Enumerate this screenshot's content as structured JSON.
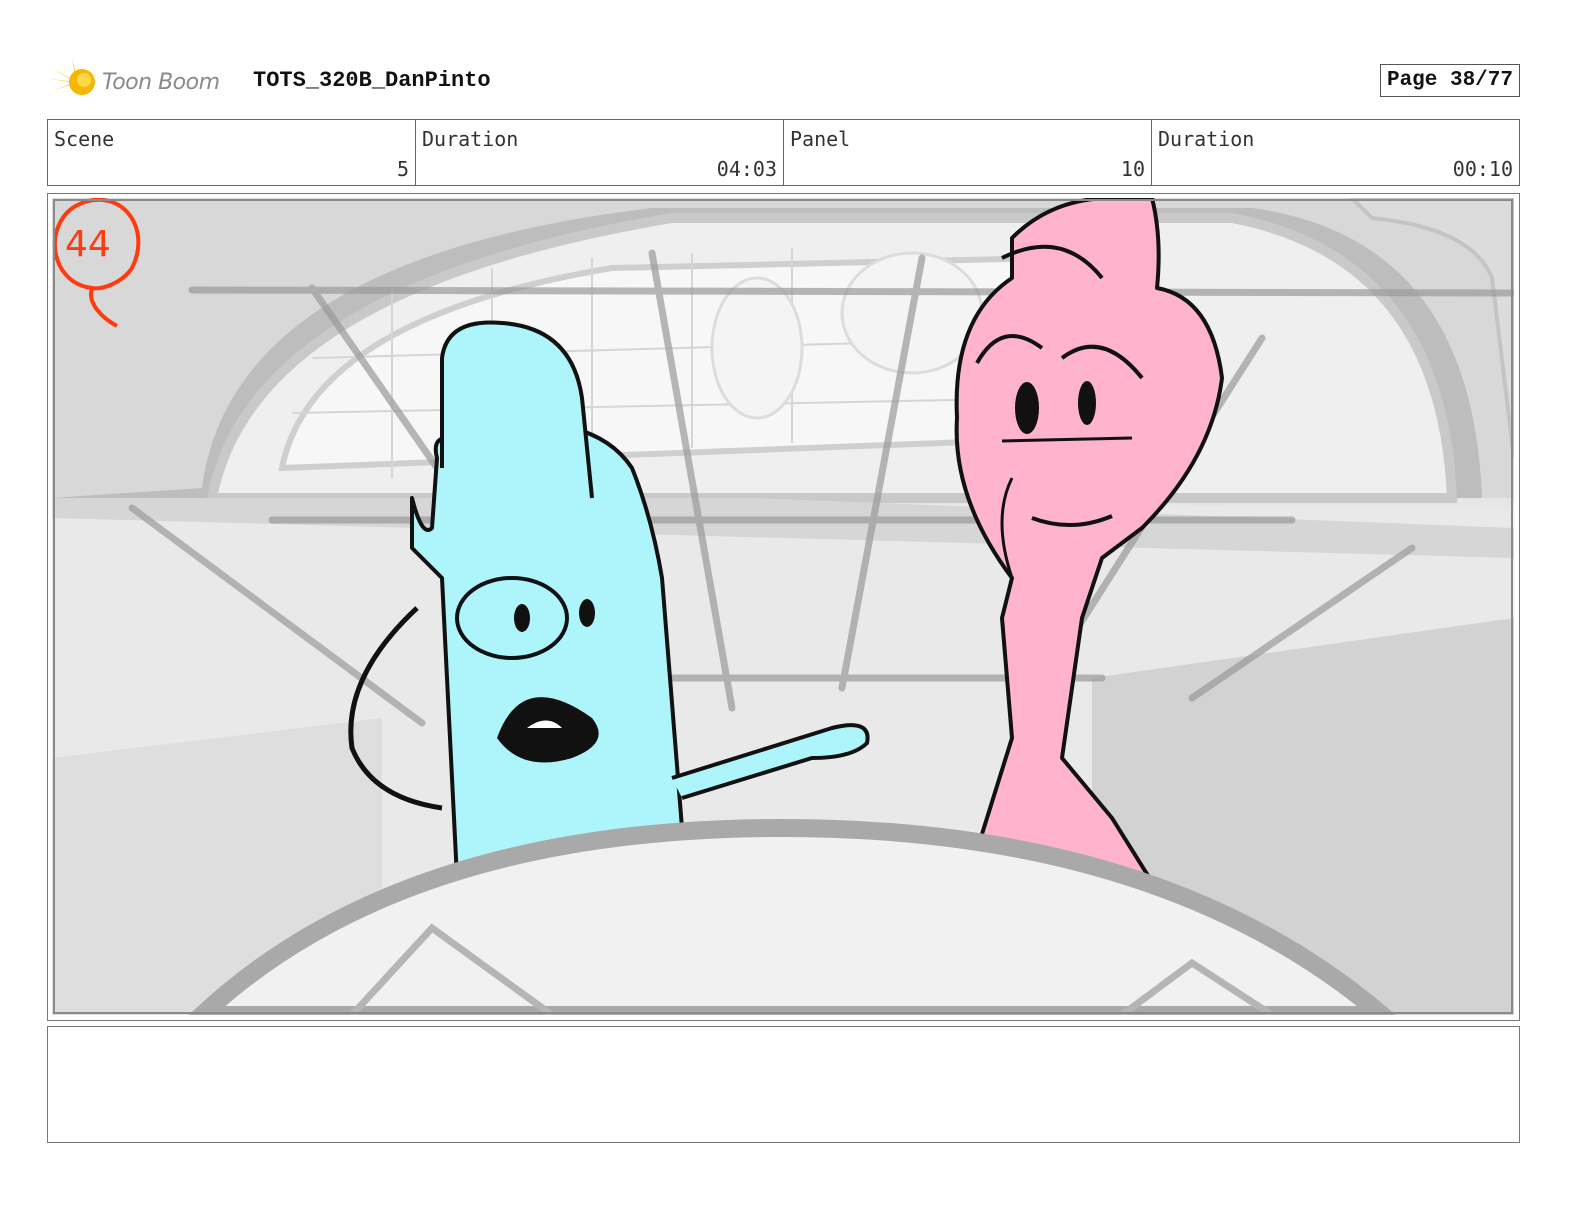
{
  "header": {
    "logo_text": "Toon Boom",
    "project_title": "TOTS_320B_DanPinto",
    "page_label": "Page 38/77"
  },
  "info": {
    "scene_label": "Scene",
    "scene_value": "5",
    "scene_duration_label": "Duration",
    "scene_duration_value": "04:03",
    "panel_label": "Panel",
    "panel_value": "10",
    "panel_duration_label": "Duration",
    "panel_duration_value": "00:10"
  },
  "panel": {
    "shot_number": "44"
  },
  "notes": {
    "text": ""
  },
  "colors": {
    "logo_yellow": "#f5c400",
    "shot_mark_red": "#ff3a10",
    "blue_character": "#aef5fb",
    "pink_character": "#ffb3cd"
  }
}
